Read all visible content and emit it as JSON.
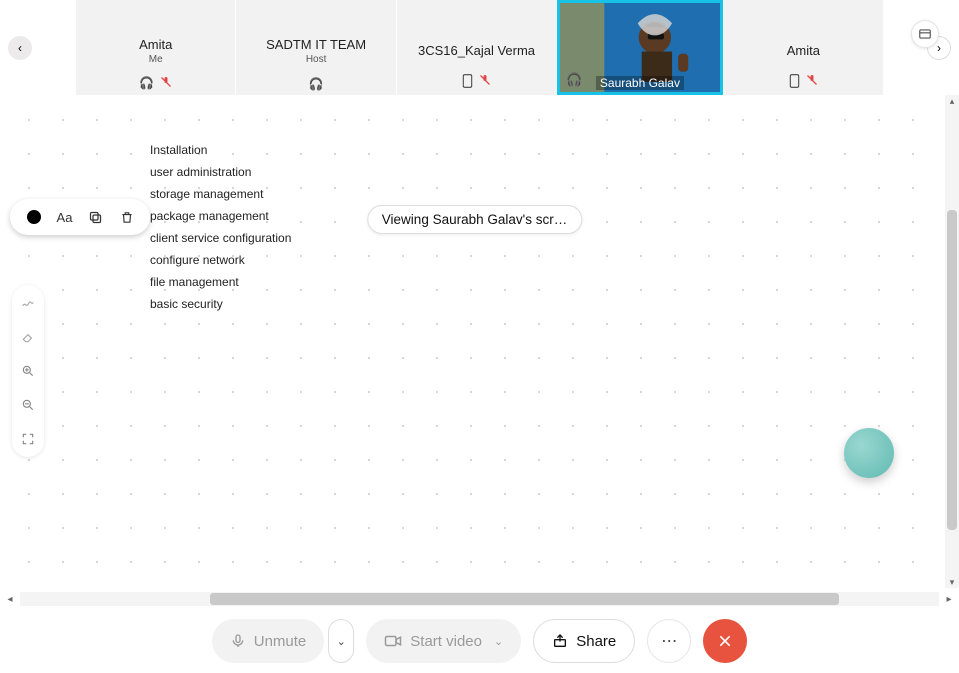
{
  "participants": [
    {
      "name": "Amita",
      "sub": "Me",
      "headset": true,
      "muted": true,
      "phone": false
    },
    {
      "name": "SADTM IT TEAM",
      "sub": "Host",
      "headset": true,
      "muted": false,
      "phone": false
    },
    {
      "name": "3CS16_Kajal Verma",
      "sub": "",
      "headset": false,
      "muted": true,
      "phone": true
    },
    {
      "name": "Saurabh Galav",
      "sub": "",
      "active": true
    },
    {
      "name": "Amita",
      "sub": "",
      "headset": false,
      "muted": true,
      "phone": true
    }
  ],
  "banner": "Viewing Saurabh Galav's scr…",
  "topics": [
    "Installation",
    "user administration",
    "storage management",
    "package management",
    "client service configuration",
    "configure network",
    "file management",
    "basic security"
  ],
  "bottom": {
    "unmute": "Unmute",
    "start_video": "Start video",
    "share": "Share"
  }
}
